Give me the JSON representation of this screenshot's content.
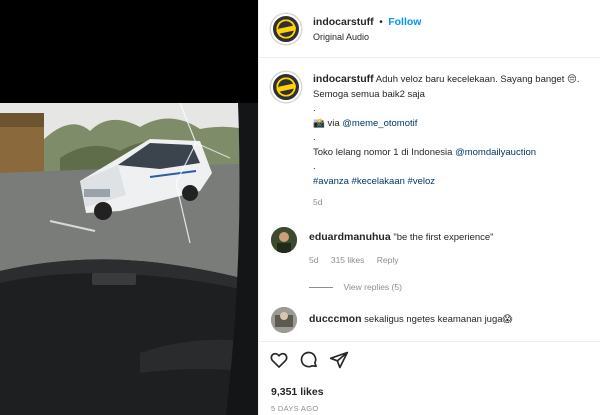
{
  "post": {
    "username": "indocarstuff",
    "dot": "•",
    "follow_label": "Follow",
    "audio_label": "Original Audio"
  },
  "caption": {
    "username": "indocarstuff",
    "line1_rest": "Aduh veloz baru kecelekaan. Sayang banget 😔.",
    "line2": "Semoga semua baik2 saja",
    "dot1": ".",
    "via_prefix": "📸 via",
    "via_mention": "@meme_otomotif",
    "dot2": ".",
    "shop_text": "Toko lelang nomor 1 di Indonesia",
    "shop_mention": "@momdailyauction",
    "dot3": ".",
    "hashtags": "#avanza #kecelakaan #veloz",
    "age": "5d"
  },
  "comments": [
    {
      "username": "eduardmanuhua",
      "text": "\"be the first experience\"",
      "age": "5d",
      "likes": "315 likes",
      "reply_label": "Reply",
      "view_replies": "View replies (5)"
    },
    {
      "username": "ducccmon",
      "text": "sekaligus ngetes keamanan juga😱"
    }
  ],
  "actions": {
    "likes_count": "9,351 likes",
    "date": "5 DAYS AGO"
  },
  "icons": {
    "like": "heart-icon",
    "comment": "comment-icon",
    "share": "share-icon"
  },
  "colors": {
    "link": "#00376b",
    "follow": "#0095f6",
    "muted": "#8e8e8e"
  }
}
